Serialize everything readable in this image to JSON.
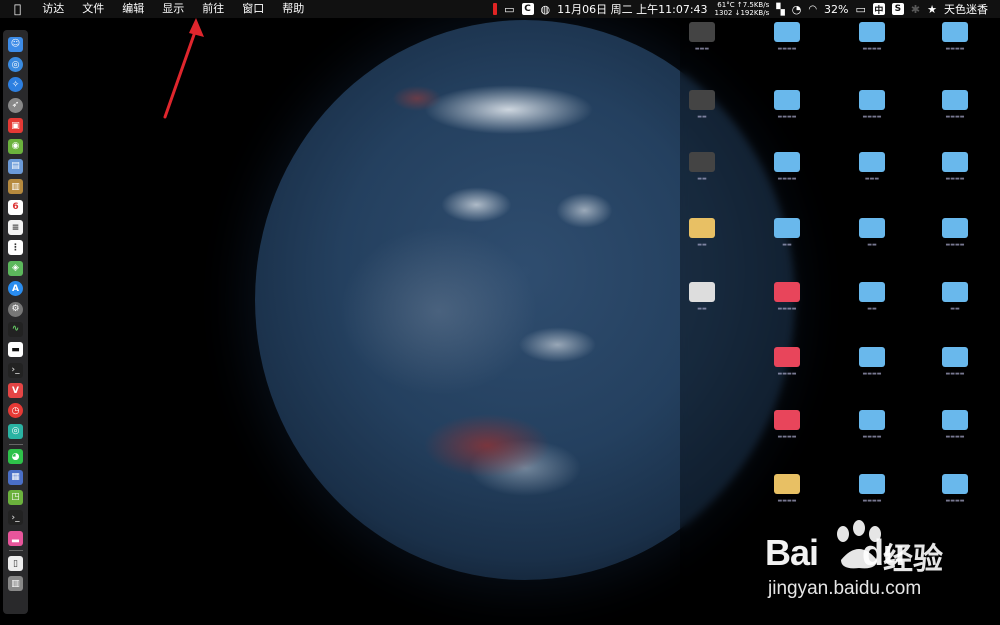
{
  "menubar": {
    "apple": "",
    "items": [
      "访达",
      "文件",
      "编辑",
      "显示",
      "前往",
      "窗口",
      "帮助"
    ]
  },
  "status": {
    "temp": "61°C",
    "net_up": "↑7.5KB/s",
    "rpm": "1302",
    "net_down": "↓192KB/s",
    "datetime": "11月06日 周二 上午11:07:43",
    "battery": "32%",
    "input": "中",
    "user": "天色迷香"
  },
  "watermark": {
    "logo_bai": "Bai",
    "logo_du": "du",
    "cn": "经验",
    "url": "jingyan.baidu.com"
  },
  "colors": {
    "accent_arrow": "#e0262d",
    "folder_blue": "#69b8ec",
    "folder_red": "#e8455b"
  }
}
